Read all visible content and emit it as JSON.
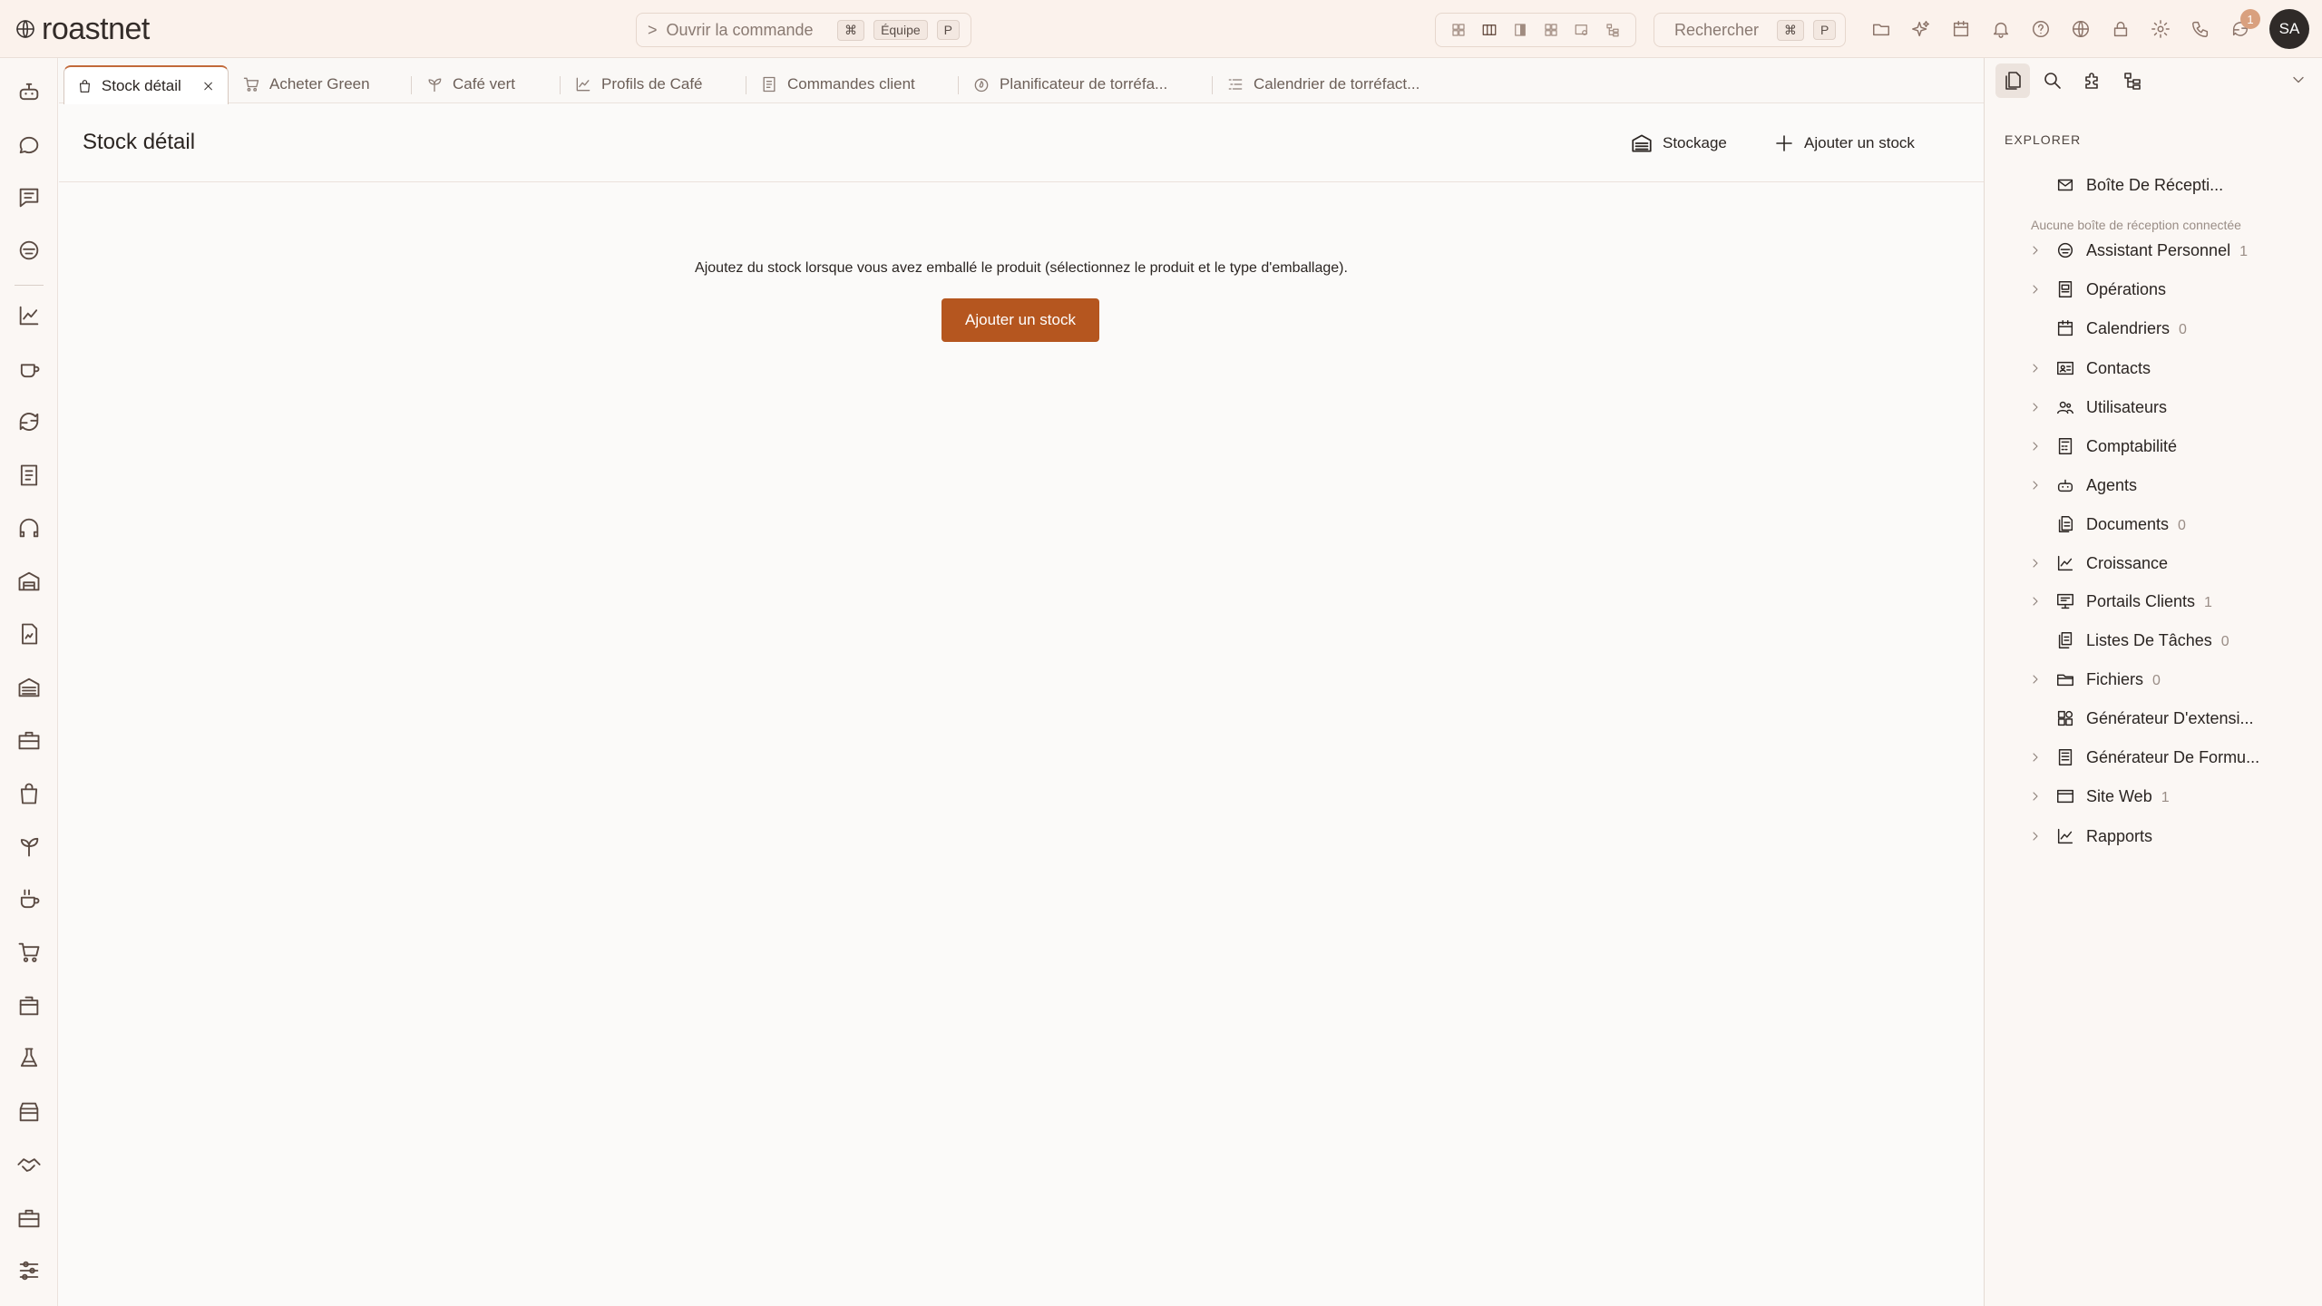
{
  "app": {
    "logo_text": "roastnet"
  },
  "topbar": {
    "command": {
      "chevron": ">",
      "label": "Ouvrir la commande",
      "kbd_cmd": "⌘",
      "kbd_team": "Équipe",
      "kbd_p": "P"
    },
    "search": {
      "label": "Rechercher",
      "kbd_cmd": "⌘",
      "kbd_p": "P"
    },
    "notifications_count": "1",
    "avatar_initials": "SA"
  },
  "tabs": [
    {
      "label": "Stock détail",
      "icon": "bag-icon",
      "active": true
    },
    {
      "label": "Acheter Green",
      "icon": "cart-icon"
    },
    {
      "label": "Café vert",
      "icon": "sprout-icon"
    },
    {
      "label": "Profils de Café",
      "icon": "chart-icon"
    },
    {
      "label": "Commandes client",
      "icon": "document-icon"
    },
    {
      "label": "Planificateur de torréfa...",
      "icon": "flame-icon"
    },
    {
      "label": "Calendrier de torréfact...",
      "icon": "list-icon"
    }
  ],
  "page": {
    "title": "Stock détail",
    "storage_button": "Stockage",
    "add_stock_button": "Ajouter un stock",
    "empty_message": "Ajoutez du stock lorsque vous avez emballé le produit (sélectionnez le produit et le type d'emballage).",
    "cta_label": "Ajouter un stock"
  },
  "explorer": {
    "title": "EXPLORER",
    "inbox_label": "Boîte De Récepti...",
    "no_inbox_text": "Aucune boîte de réception connectée",
    "items": [
      {
        "label": "Assistant Personnel",
        "count": "1",
        "expandable": true,
        "icon": "assistant-icon"
      },
      {
        "label": "Opérations",
        "count": "",
        "expandable": true,
        "icon": "operations-icon"
      },
      {
        "label": "Calendriers",
        "count": "0",
        "expandable": false,
        "icon": "calendar-icon"
      },
      {
        "label": "Contacts",
        "count": "",
        "expandable": true,
        "icon": "contact-card-icon"
      },
      {
        "label": "Utilisateurs",
        "count": "",
        "expandable": true,
        "icon": "users-icon"
      },
      {
        "label": "Comptabilité",
        "count": "",
        "expandable": true,
        "icon": "calculator-icon"
      },
      {
        "label": "Agents",
        "count": "",
        "expandable": true,
        "icon": "robot-icon"
      },
      {
        "label": "Documents",
        "count": "0",
        "expandable": false,
        "icon": "documents-icon"
      },
      {
        "label": "Croissance",
        "count": "",
        "expandable": true,
        "icon": "growth-chart-icon"
      },
      {
        "label": "Portails Clients",
        "count": "1",
        "expandable": true,
        "icon": "portal-icon"
      },
      {
        "label": "Listes De Tâches",
        "count": "0",
        "expandable": false,
        "icon": "task-list-icon"
      },
      {
        "label": "Fichiers",
        "count": "0",
        "expandable": true,
        "icon": "folder-icon"
      },
      {
        "label": "Générateur D'extensi...",
        "count": "",
        "expandable": false,
        "icon": "extension-icon"
      },
      {
        "label": "Générateur De Formu...",
        "count": "",
        "expandable": true,
        "icon": "form-icon"
      },
      {
        "label": "Site Web",
        "count": "1",
        "expandable": true,
        "icon": "browser-icon"
      },
      {
        "label": "Rapports",
        "count": "",
        "expandable": true,
        "icon": "reports-icon"
      }
    ]
  },
  "colors": {
    "accent": "#b5561f",
    "active_tab_border": "#c26a3a",
    "topbar_bg": "#fbf2ec"
  }
}
